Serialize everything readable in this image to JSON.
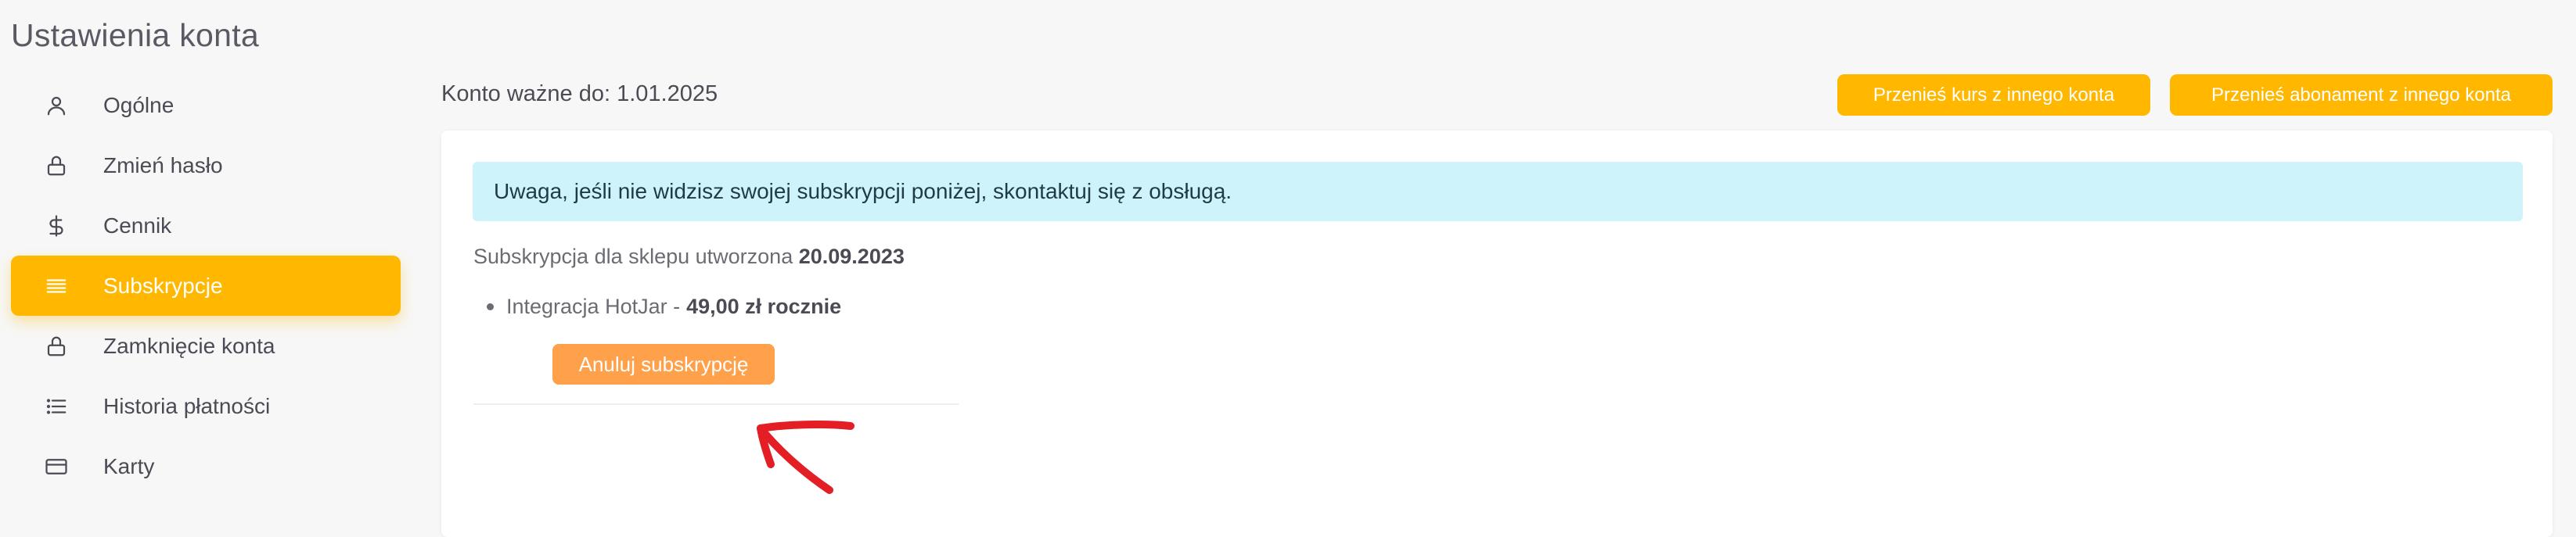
{
  "page": {
    "title": "Ustawienia konta"
  },
  "sidebar": {
    "items": [
      {
        "label": "Ogólne",
        "icon": "user-icon"
      },
      {
        "label": "Zmień hasło",
        "icon": "lock-icon"
      },
      {
        "label": "Cennik",
        "icon": "dollar-icon"
      },
      {
        "label": "Subskrypcje",
        "icon": "lines-icon",
        "active": true
      },
      {
        "label": "Zamknięcie konta",
        "icon": "lock-icon"
      },
      {
        "label": "Historia płatności",
        "icon": "list-icon"
      },
      {
        "label": "Karty",
        "icon": "credit-card-icon"
      }
    ]
  },
  "header": {
    "account_valid": "Konto ważne do: 1.01.2025",
    "transfer_course_label": "Przenieś kurs z innego konta",
    "transfer_subscription_label": "Przenieś abonament z innego konta"
  },
  "main": {
    "alert_text": "Uwaga, jeśli nie widzisz swojej subskrypcji poniżej, skontaktuj się z obsługą.",
    "subscription_prefix": "Subskrypcja dla sklepu utworzona",
    "subscription_date": "20.09.2023",
    "item_name": "Integracja HotJar -",
    "item_price": "49,00 zł rocznie",
    "cancel_label": "Anuluj subskrypcję"
  },
  "colors": {
    "accent": "#ffb700",
    "cancel": "#ffa14a",
    "alert_bg": "#cff3fb",
    "arrow": "#e31e24"
  }
}
